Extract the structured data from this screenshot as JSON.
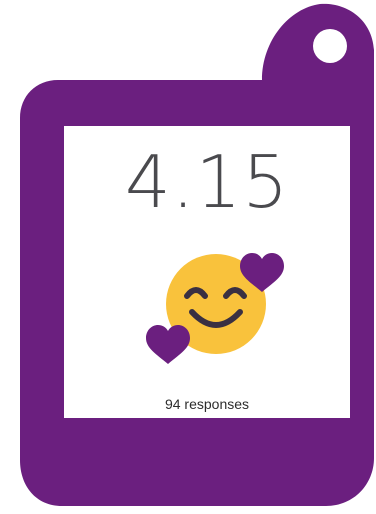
{
  "rating": {
    "score": "4.15",
    "responses_label": "94 responses"
  },
  "icons": {
    "emoji": "smiling-face-with-hearts-icon"
  },
  "colors": {
    "tag": "#6b1f7f",
    "emoji_face": "#f9c23c",
    "heart": "#6b1f7f",
    "score_text": "#4a4a4e"
  }
}
